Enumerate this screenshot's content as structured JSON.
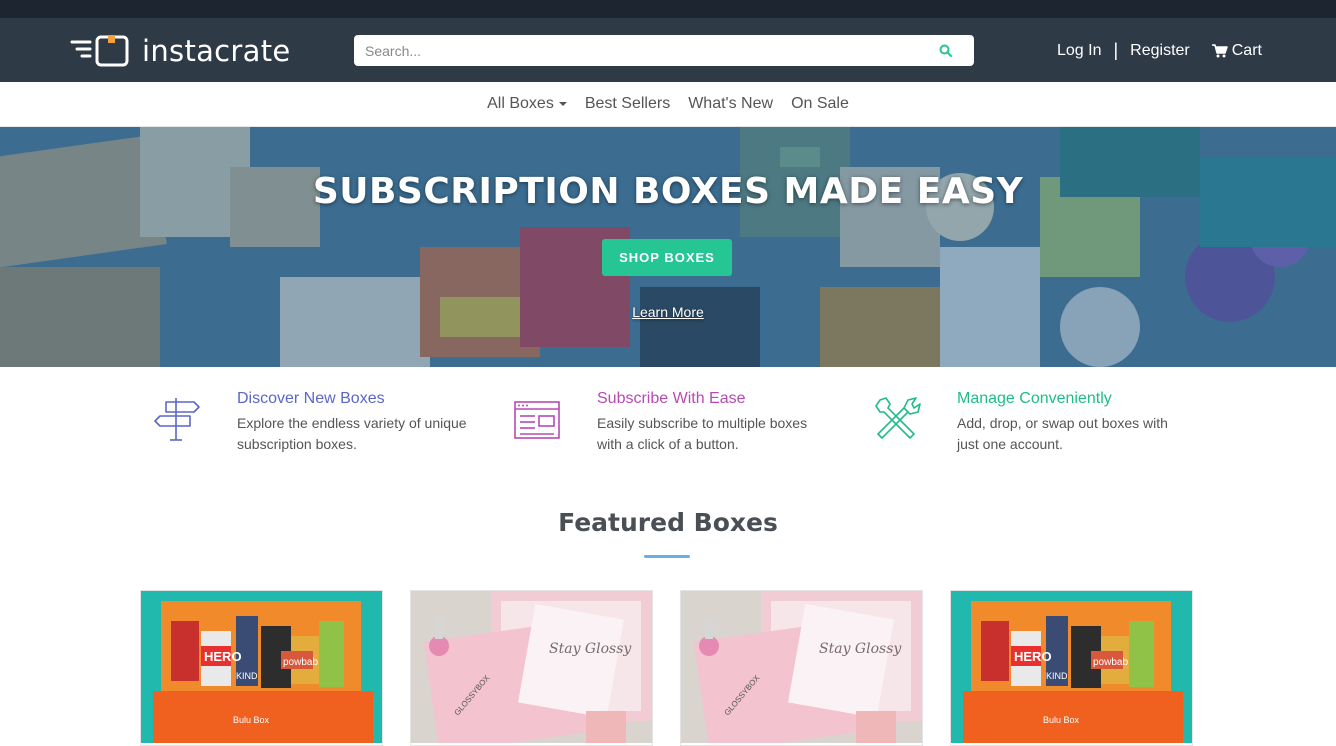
{
  "brand": {
    "name": "instacrate"
  },
  "search": {
    "placeholder": "Search..."
  },
  "auth": {
    "login": "Log In",
    "separator": "|",
    "register": "Register",
    "cart": "Cart"
  },
  "nav": {
    "items": [
      "All Boxes",
      "Best Sellers",
      "What's New",
      "On Sale"
    ]
  },
  "hero": {
    "title": "SUBSCRIPTION BOXES MADE EASY",
    "button": "SHOP BOXES",
    "link": "Learn More"
  },
  "features": [
    {
      "title": "Discover New Boxes",
      "text": "Explore the endless variety of unique subscription boxes.",
      "color": "#5b66c9",
      "icon": "signpost-icon"
    },
    {
      "title": "Subscribe With Ease",
      "text": "Easily subscribe to multiple boxes with a click of a button.",
      "color": "#b84ab5",
      "icon": "browser-window-icon"
    },
    {
      "title": "Manage Conveniently",
      "text": "Add, drop, or swap out boxes with just one account.",
      "color": "#1fbd85",
      "icon": "tools-icon"
    }
  ],
  "featured": {
    "title": "Featured Boxes"
  },
  "cards": [
    {
      "image": "bulu-box-image",
      "box_label": "Bulu Box",
      "items": [
        "HERO",
        "powbab",
        "KIND"
      ]
    },
    {
      "image": "glossybox-image",
      "box_label": "GLOSSYBOX",
      "card_text": "Stay Glossy"
    },
    {
      "image": "glossybox-image",
      "box_label": "GLOSSYBOX",
      "card_text": "Stay Glossy"
    },
    {
      "image": "bulu-box-image",
      "box_label": "Bulu Box",
      "items": [
        "HERO",
        "powbab",
        "KIND"
      ]
    }
  ],
  "colors": {
    "header": "#2f3a47",
    "accent": "#25c694",
    "hero_overlay": "#285f8c"
  }
}
